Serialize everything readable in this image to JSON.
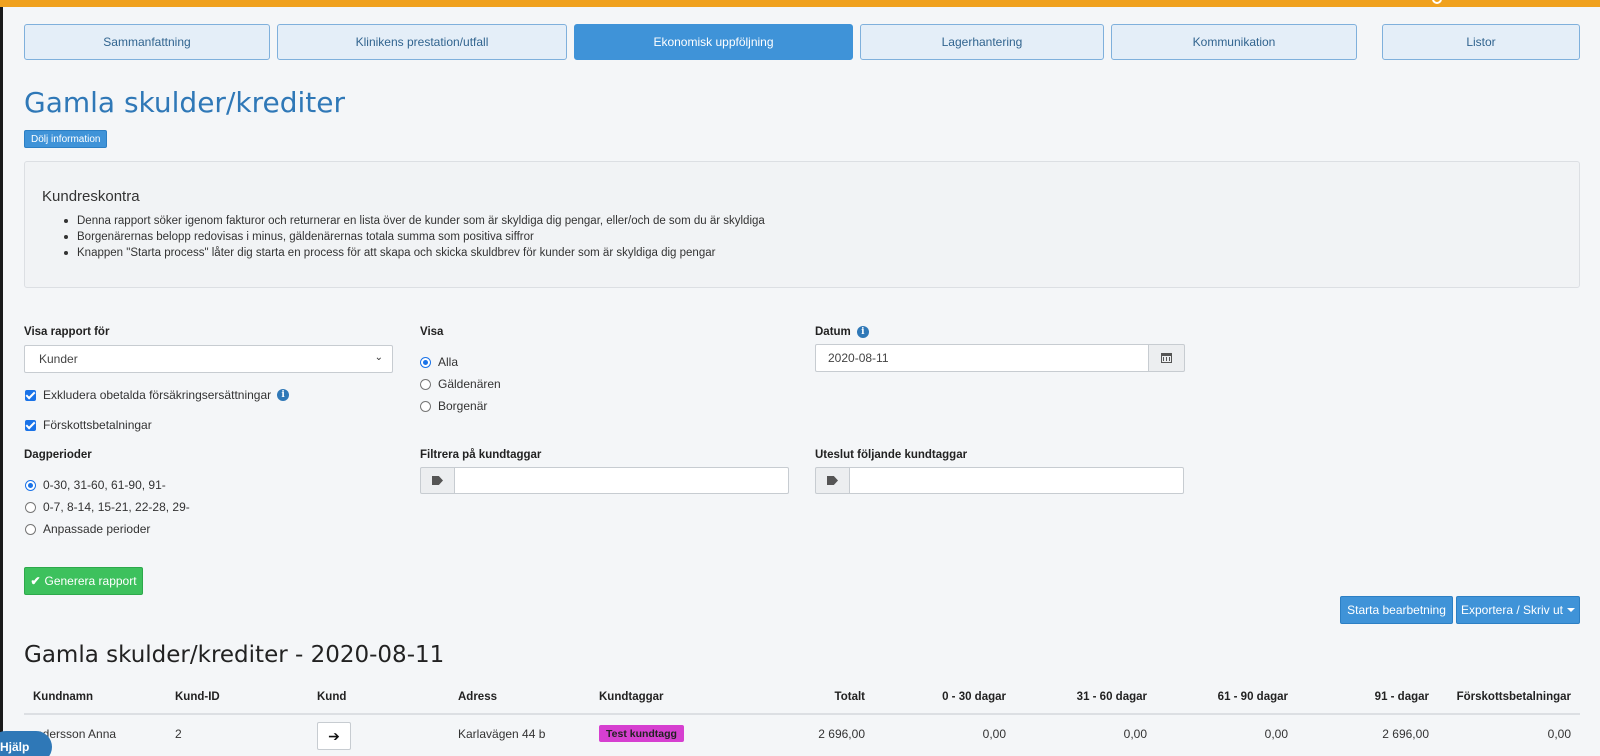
{
  "tabs": [
    {
      "label": "Sammanfattning",
      "active": false
    },
    {
      "label": "Klinikens prestation/utfall",
      "active": false
    },
    {
      "label": "Ekonomisk uppföljning",
      "active": true
    },
    {
      "label": "Lagerhantering",
      "active": false
    },
    {
      "label": "Kommunikation",
      "active": false
    },
    {
      "label": "Listor",
      "active": false
    }
  ],
  "page": {
    "title": "Gamla skulder/krediter",
    "hide_info_label": "Dölj information"
  },
  "info": {
    "title": "Kundreskontra",
    "items": [
      "Denna rapport söker igenom fakturor och returnerar en lista över de kunder som är skyldiga dig pengar, eller/och de som du är skyldiga",
      "Borgenärernas belopp redovisas i minus, gäldenärernas totala summa som positiva siffror",
      "Knappen \"Starta process\" låter dig starta en process för att skapa och skicka skuldbrev för kunder som är skyldiga dig pengar"
    ]
  },
  "form": {
    "report_for_label": "Visa rapport för",
    "report_for_value": "Kunder",
    "exclude_label": "Exkludera obetalda försäkringsersättningar",
    "exclude_checked": true,
    "prepayments_label": "Förskottsbetalningar",
    "prepayments_checked": true,
    "day_periods_label": "Dagperioder",
    "day_periods": [
      {
        "label": "0-30, 31-60, 61-90, 91-",
        "selected": true
      },
      {
        "label": "0-7, 8-14, 15-21, 22-28, 29-",
        "selected": false
      },
      {
        "label": "Anpassade perioder",
        "selected": false
      }
    ],
    "show_label": "Visa",
    "show_options": [
      {
        "label": "Alla",
        "selected": true
      },
      {
        "label": "Gäldenären",
        "selected": false
      },
      {
        "label": "Borgenär",
        "selected": false
      }
    ],
    "date_label": "Datum",
    "date_value": "2020-08-11",
    "filter_tags_label": "Filtrera på kundtaggar",
    "exclude_tags_label": "Uteslut följande kundtaggar",
    "generate_label": "Generera rapport"
  },
  "actions": {
    "start_processing": "Starta bearbetning",
    "export_print": "Exportera / Skriv ut"
  },
  "report": {
    "title": "Gamla skulder/krediter - 2020-08-11",
    "columns": [
      "Kundnamn",
      "Kund-ID",
      "Kund",
      "Adress",
      "Kundtaggar",
      "Totalt",
      "0 - 30 dagar",
      "31 - 60 dagar",
      "61 - 90 dagar",
      "91 - dagar",
      "Förskottsbetalningar"
    ],
    "rows": [
      {
        "name": "Andersson Anna",
        "name_visible": "ndersson Anna",
        "id": "2",
        "address": "Karlavägen 44 b",
        "tag": "Test kundtagg",
        "total": "2 696,00",
        "d0_30": "0,00",
        "d31_60": "0,00",
        "d61_90": "0,00",
        "d91": "2 696,00",
        "prepay": "0,00"
      }
    ]
  },
  "help_label": "Hjälp",
  "colors": {
    "accent": "#3f93d8",
    "title": "#2f78b7",
    "success": "#3dc15d",
    "top_bar": "#f0a11e",
    "tag": "#d63fd0"
  }
}
